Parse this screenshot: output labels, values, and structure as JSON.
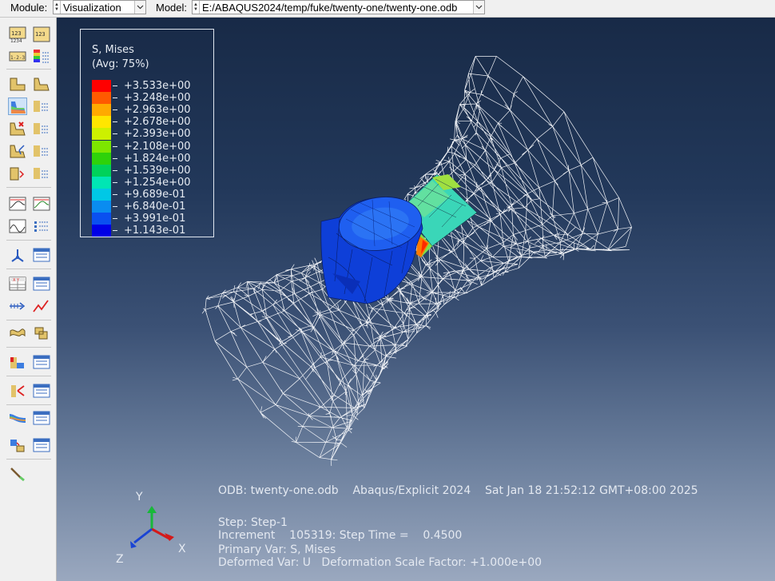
{
  "toolbar": {
    "module_label": "Module:",
    "module_value": "Visualization",
    "model_label": "Model:",
    "model_value": "E:/ABAQUS2024/temp/fuke/twenty-one/twenty-one.odb"
  },
  "legend": {
    "title": "S, Mises",
    "subtitle": "(Avg: 75%)",
    "values": [
      "+3.533e+00",
      "+3.248e+00",
      "+2.963e+00",
      "+2.678e+00",
      "+2.393e+00",
      "+2.108e+00",
      "+1.824e+00",
      "+1.539e+00",
      "+1.254e+00",
      "+9.689e-01",
      "+6.840e-01",
      "+3.991e-01",
      "+1.143e-01"
    ],
    "colors": [
      "#ff0000",
      "#ff5a00",
      "#ffaa00",
      "#ffe600",
      "#cdf000",
      "#7de600",
      "#2ed20a",
      "#00d25a",
      "#00e6b4",
      "#00c8e6",
      "#0a8cf0",
      "#0a50f0",
      "#0000e6"
    ]
  },
  "triad": {
    "x": "X",
    "y": "Y",
    "z": "Z"
  },
  "info": {
    "odb_line": "ODB: twenty-one.odb    Abaqus/Explicit 2024    Sat Jan 18 21:52:12 GMT+08:00 2025",
    "step_line": "Step: Step-1",
    "increment_line": "Increment    105319: Step Time =    0.4500",
    "primary_line": "Primary Var: S, Mises",
    "deformed_line": "Deformed Var: U   Deformation Scale Factor: +1.000e+00"
  },
  "icons": [
    "query-icon",
    "common-options-icon",
    "plot-undeformed-icon",
    "plot-deformed-icon",
    "contour-plot-icon",
    "symbol-plot-icon",
    "material-orientation-icon",
    "animate-scale-icon",
    "animate-time-icon",
    "xy-data-icon",
    "create-path-icon",
    "display-group-icon",
    "view-cut-icon",
    "stream-icon",
    "probe-icon"
  ]
}
